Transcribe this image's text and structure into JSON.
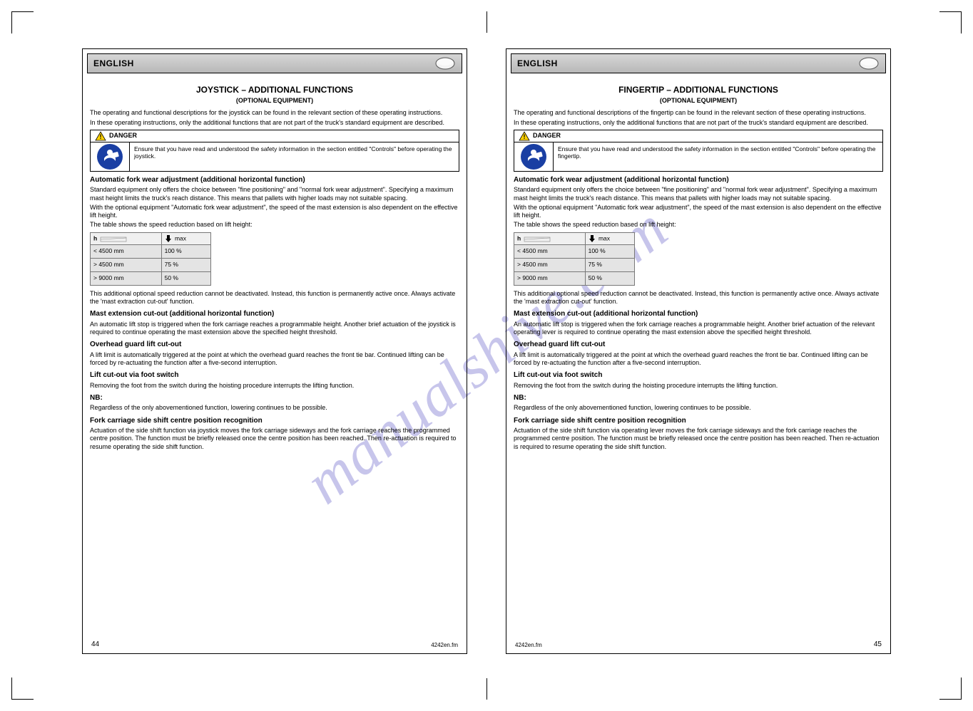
{
  "watermark": "manualshive.com",
  "footnote": "4242en.fm",
  "pages": [
    {
      "number": "44",
      "lang": "ENGLISH",
      "title": "JOYSTICK – ADDITIONAL FUNCTIONS",
      "subtitle": "(OPTIONAL EQUIPMENT)",
      "intro1": "The operating and functional descriptions for the joystick can be found in the relevant section of these operating instructions.",
      "intro2": "In these operating instructions, only the additional functions that are not part of the truck's standard equipment are described.",
      "warn": {
        "label": "DANGER",
        "text": "Ensure that you have read and understood the safety information in the section entitled \"Controls\" before operating the joystick."
      },
      "s1": {
        "h": "Automatic fork wear adjustment (additional horizontal function)",
        "p1": "Standard equipment only offers the choice between \"fine positioning\" and \"normal fork wear adjustment\". Specifying a maximum mast height limits the truck's reach distance. This means that pallets with higher loads may not suitable spacing.",
        "p2": "With the optional equipment \"Automatic fork wear adjustment\", the speed of the mast extension is also dependent on the effective lift height.",
        "p3": "The table shows the speed reduction based on lift height:"
      },
      "tbl": {
        "r1": [
          "< 4500 mm",
          "100 %"
        ],
        "r2": [
          "> 4500 mm",
          "75 %"
        ],
        "r3": [
          "> 9000 mm",
          "50 %"
        ]
      },
      "extra": "This additional optional speed reduction cannot be deactivated. Instead, this function is permanently active once. Always activate the 'mast extraction cut-out' function.",
      "s2": {
        "h": "Mast extension cut-out (additional horizontal function)",
        "p": "An automatic lift stop is triggered when the fork carriage reaches a programmable height. Another brief actuation of the joystick is required to continue operating the mast extension above the specified height threshold."
      },
      "s3": {
        "h": "Overhead guard lift cut-out",
        "p": "A lift limit is automatically triggered at the point at which the overhead guard reaches the front tie bar. Continued lifting can be forced by re-actuating the function after a five-second interruption."
      },
      "s4": {
        "h": "Lift cut-out via foot switch",
        "p": "Removing the foot from the switch during the hoisting procedure interrupts the lifting function."
      },
      "nb": {
        "h": "NB:",
        "p": "Regardless of the only abovementioned function, lowering continues to be possible."
      },
      "s5": {
        "h": "Fork carriage side shift centre position recognition",
        "p": "Actuation of the side shift function via joystick moves the fork carriage sideways and the fork carriage reaches the programmed centre position. The function must be briefly released once the centre position has been reached. Then re-actuation is required to resume operating the side shift function."
      }
    },
    {
      "number": "45",
      "lang": "ENGLISH",
      "title": "FINGERTIP – ADDITIONAL FUNCTIONS",
      "subtitle": "(OPTIONAL EQUIPMENT)",
      "intro1": "The operating and functional descriptions of the fingertip can be found in the relevant section of these operating instructions.",
      "intro2": "In these operating instructions, only the additional functions that are not part of the truck's standard equipment are described.",
      "warn": {
        "label": "DANGER",
        "text": "Ensure that you have read and understood the safety information in the section entitled \"Controls\" before operating the fingertip."
      },
      "s1": {
        "h": "Automatic fork wear adjustment (additional horizontal function)",
        "p1": "Standard equipment only offers the choice between \"fine positioning\" and \"normal fork wear adjustment\". Specifying a maximum mast height limits the truck's reach distance. This means that pallets with higher loads may not suitable spacing.",
        "p2": "With the optional equipment \"Automatic fork wear adjustment\", the speed of the mast extension is also dependent on the effective lift height.",
        "p3": "The table shows the speed reduction based on lift height:"
      },
      "tbl": {
        "r1": [
          "< 4500 mm",
          "100 %"
        ],
        "r2": [
          "> 4500 mm",
          "75 %"
        ],
        "r3": [
          "> 9000 mm",
          "50 %"
        ]
      },
      "extra": "This additional optional speed reduction cannot be deactivated. Instead, this function is permanently active once. Always activate the 'mast extraction cut-out' function.",
      "s2": {
        "h": "Mast extension cut-out (additional horizontal function)",
        "p": "An automatic lift stop is triggered when the fork carriage reaches a programmable height. Another brief actuation of the relevant operating lever is required to continue operating the mast extension above the specified height threshold."
      },
      "s3": {
        "h": "Overhead guard lift cut-out",
        "p": "A lift limit is automatically triggered at the point at which the overhead guard reaches the front tie bar. Continued lifting can be forced by re-actuating the function after a five-second interruption."
      },
      "s4": {
        "h": "Lift cut-out via foot switch",
        "p": "Removing the foot from the switch during the hoisting procedure interrupts the lifting function."
      },
      "nb": {
        "h": "NB:",
        "p": "Regardless of the only abovementioned function, lowering continues to be possible."
      },
      "s5": {
        "h": "Fork carriage side shift centre position recognition",
        "p": "Actuation of the side shift function via operating lever moves the fork carriage sideways and the fork carriage reaches the programmed centre position. The function must be briefly released once the centre position has been reached. Then re-actuation is required to resume operating the side shift function."
      }
    }
  ]
}
